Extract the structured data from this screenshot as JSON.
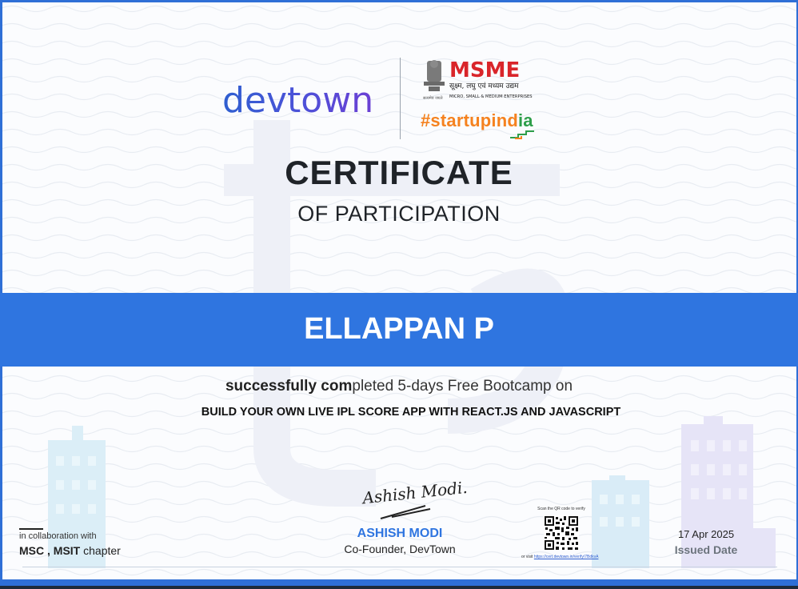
{
  "logos": {
    "devtown": "devtown",
    "msme_title": "MSME",
    "msme_hindi": "सूक्ष्म, लघु एवं मध्यम उद्यम",
    "msme_english": "MICRO, SMALL & MEDIUM ENTERPRISES",
    "emblem_caption": "सत्यमेव जयते",
    "startupindia_prefix": "#startupind",
    "startupindia_suffix": "ia"
  },
  "certificate": {
    "title": "CERTIFICATE",
    "subtitle": "OF PARTICIPATION",
    "recipient_name": "ELLAPPAN P",
    "completion_bold": "successfully com",
    "completion_rest": "pleted 5-days Free Bootcamp on",
    "course_title": "BUILD YOUR OWN LIVE IPL SCORE APP WITH REACT.JS AND JAVASCRIPT"
  },
  "signatory": {
    "signature_text": "Ashish Modi.",
    "name": "ASHISH MODI",
    "role": "Co-Founder, DevTown"
  },
  "verification": {
    "qr_caption": "Scan the QR code to verify",
    "link_prefix": "or visit ",
    "link": "https://cert.devtown.in/verify/7BdkvA"
  },
  "issue": {
    "date": "17 Apr 2025",
    "label": "Issued Date"
  },
  "collaboration": {
    "label": "in collaboration with",
    "org_bold": "MSC , MSIT",
    "org_rest": " chapter"
  },
  "colors": {
    "brand_blue": "#2f75e0",
    "devtown_blue": "#2f5fd0",
    "devtown_purple": "#6b3fd4",
    "msme_red": "#d9252a",
    "startup_orange": "#f5821f",
    "startup_green": "#2e9e4a"
  }
}
